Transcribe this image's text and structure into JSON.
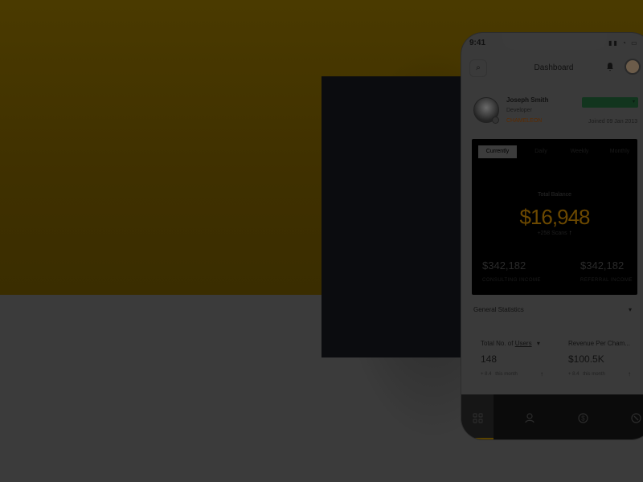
{
  "status": {
    "time": "9:41",
    "icons": "▮▮ ◔ ▭"
  },
  "header": {
    "title": "Dashboard",
    "search_icon": "⌕",
    "bell_icon": "🔔"
  },
  "profile": {
    "name": "Joseph Smith",
    "role": "Developer",
    "company": "CHAMELEON",
    "status_label": "",
    "joined": "Joined 09 Jan 2013"
  },
  "balance": {
    "tabs": [
      "Currently",
      "Daily",
      "Weekly",
      "Monthly"
    ],
    "active_tab": "Currently",
    "label": "Total Balance",
    "amount": "$16,948",
    "delta": "+258 Scans",
    "incomes": [
      {
        "value": "$342,182",
        "label": "CONSULTING INCOME"
      },
      {
        "value": "$342,182",
        "label": "REFERRAL INCOME"
      }
    ]
  },
  "general_statistics": {
    "title": "General Statistics"
  },
  "stats": [
    {
      "title_prefix": "Total No. of ",
      "title_link": "Users",
      "value": "148",
      "footer": "+ 8.4",
      "footer_note": "this month"
    },
    {
      "title": "Revenue Per Cham...",
      "value": "$100.5K",
      "footer": "+ 8.4",
      "footer_note": "this month"
    }
  ],
  "nav": {
    "icons": [
      "grid-icon",
      "user-icon",
      "dollar-icon",
      "tools-icon"
    ]
  }
}
